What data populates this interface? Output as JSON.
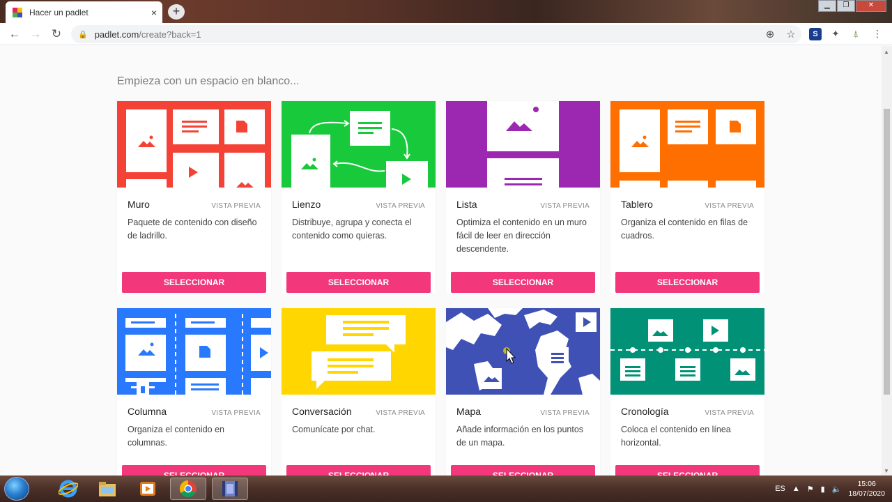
{
  "browser": {
    "tab_title": "Hacer un padlet",
    "tab_close": "×",
    "new_tab": "+",
    "url_host": "padlet.com",
    "url_path": "/create?back=1"
  },
  "page": {
    "heading": "Empieza con un espacio en blanco..."
  },
  "colors": {
    "accent": "#f2377b",
    "muro": "#f44336",
    "lienzo": "#19c93c",
    "lista": "#9c27b0",
    "tablero": "#ff6f00",
    "columna": "#2979ff",
    "conversacion": "#ffd600",
    "mapa": "#3f51b5",
    "cronologia": "#009177"
  },
  "cards": [
    {
      "name": "Muro",
      "preview": "VISTA PREVIA",
      "desc": "Paquete de contenido con diseño de ladrillo.",
      "button": "SELECCIONAR"
    },
    {
      "name": "Lienzo",
      "preview": "VISTA PREVIA",
      "desc": "Distribuye, agrupa y conecta el contenido como quieras.",
      "button": "SELECCIONAR"
    },
    {
      "name": "Lista",
      "preview": "VISTA PREVIA",
      "desc": "Optimiza el contenido en un muro fácil de leer en dirección descendente.",
      "button": "SELECCIONAR"
    },
    {
      "name": "Tablero",
      "preview": "VISTA PREVIA",
      "desc": "Organiza el contenido en filas de cuadros.",
      "button": "SELECCIONAR"
    },
    {
      "name": "Columna",
      "preview": "VISTA PREVIA",
      "desc": "Organiza el contenido en columnas.",
      "button": "SELECCIONAR"
    },
    {
      "name": "Conversación",
      "preview": "VISTA PREVIA",
      "desc": "Comunícate por chat.",
      "button": "SELECCIONAR"
    },
    {
      "name": "Mapa",
      "preview": "VISTA PREVIA",
      "desc": "Añade información en los puntos de un mapa.",
      "button": "SELECCIONAR"
    },
    {
      "name": "Cronología",
      "preview": "VISTA PREVIA",
      "desc": "Coloca el contenido en línea horizontal.",
      "button": "SELECCIONAR"
    }
  ],
  "taskbar": {
    "lang": "ES",
    "time": "15:06",
    "date": "18/07/2020"
  }
}
